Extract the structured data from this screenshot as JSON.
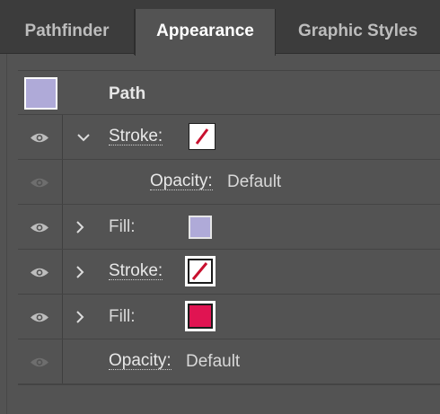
{
  "tabs": [
    {
      "label": "Pathfinder",
      "active": false
    },
    {
      "label": "Appearance",
      "active": true
    },
    {
      "label": "Graphic Styles",
      "active": false
    }
  ],
  "object": {
    "title": "Path",
    "swatch_color": "#afaad8"
  },
  "rows": [
    {
      "label": "Stroke:",
      "expanded": true,
      "visible": true,
      "swatch": "stroke-none-red",
      "slash_color": "#c8102e"
    },
    {
      "label": "Opacity:",
      "value": "Default",
      "visible": false
    },
    {
      "label": "Fill:",
      "expanded": false,
      "visible": true,
      "swatch_color": "#afaad8"
    },
    {
      "label": "Stroke:",
      "expanded": false,
      "visible": true,
      "swatch": "stroke-none-red",
      "slash_color": "#c8102e"
    },
    {
      "label": "Fill:",
      "expanded": false,
      "visible": true,
      "swatch_color": "#e01452"
    },
    {
      "label": "Opacity:",
      "value": "Default",
      "visible": false
    }
  ],
  "icons": {
    "visibility": "eye-icon",
    "expanded": "chevron-down-icon",
    "collapsed": "chevron-right-icon"
  },
  "colors": {
    "panel_bg": "#535353",
    "tabbar_bg": "#3c3c3c",
    "text": "#e8e8e8"
  }
}
